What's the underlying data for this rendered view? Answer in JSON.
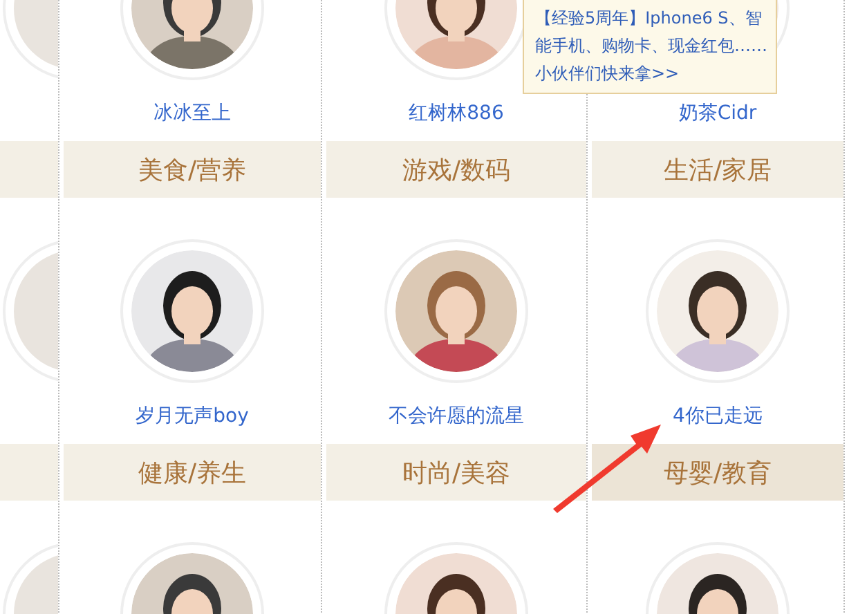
{
  "tooltip": {
    "text": "【经验5周年】Iphone6 S、智能手机、购物卡、现金红包……小伙伴们快来拿>>"
  },
  "rows": [
    {
      "cells": [
        {
          "kind": "user",
          "name": "冰冰至上",
          "category": "美食/营养",
          "selected": false
        },
        {
          "kind": "user",
          "name": "红树林886",
          "category": "游戏/数码",
          "selected": false
        },
        {
          "kind": "user",
          "name": "奶茶Cidr",
          "category": "生活/家居",
          "selected": false
        }
      ]
    },
    {
      "cells": [
        {
          "kind": "user",
          "name": "岁月无声boy",
          "category": "健康/养生",
          "selected": false
        },
        {
          "kind": "user",
          "name": "不会许愿的流星",
          "category": "时尚/美容",
          "selected": false
        },
        {
          "kind": "user",
          "name": "4你已走远",
          "category": "母婴/教育",
          "selected": true
        }
      ]
    },
    {
      "cells": [
        {
          "kind": "avatar"
        },
        {
          "kind": "avatar"
        },
        {
          "kind": "avatar"
        }
      ]
    }
  ]
}
